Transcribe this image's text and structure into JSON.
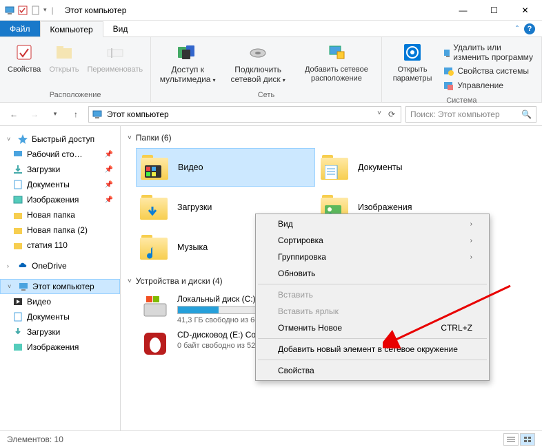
{
  "window": {
    "title": "Этот компьютер"
  },
  "winControls": {
    "min": "—",
    "max": "☐",
    "close": "✕"
  },
  "menuTabs": {
    "file": "Файл",
    "computer": "Компьютер",
    "view": "Вид"
  },
  "ribbon": {
    "group1": {
      "label": "Расположение",
      "props": "Свойства",
      "open": "Открыть",
      "rename": "Переименовать"
    },
    "group2": {
      "label": "Сеть",
      "media": "Доступ к мультимедиа",
      "mapDrive": "Подключить сетевой диск",
      "addNet": "Добавить сетевое расположение"
    },
    "group3": {
      "label": "Система",
      "settings": "Открыть параметры",
      "uninstall": "Удалить или изменить программу",
      "sysprops": "Свойства системы",
      "manage": "Управление"
    }
  },
  "address": {
    "text": "Этот компьютер"
  },
  "search": {
    "placeholder": "Поиск: Этот компьютер"
  },
  "sidebar": {
    "quick": "Быстрый доступ",
    "desktop": "Рабочий сто…",
    "downloads": "Загрузки",
    "documents": "Документы",
    "pictures": "Изображения",
    "newFolder": "Новая папка",
    "newFolder2": "Новая папка (2)",
    "statiya": "статия 110",
    "onedrive": "OneDrive",
    "thispc": "Этот компьютер",
    "videos": "Видео",
    "documents2": "Документы",
    "downloads2": "Загрузки",
    "pictures2": "Изображения"
  },
  "sections": {
    "folders": "Папки (6)",
    "devices": "Устройства и диски (4)"
  },
  "folders": {
    "videos": "Видео",
    "documents": "Документы",
    "downloads": "Загрузки",
    "pictures": "Изображения",
    "music": "Музыка"
  },
  "drives": {
    "c": {
      "name": "Локальный диск (C:)",
      "info": "41,3 ГБ свободно из 60,6…",
      "fillPct": 33
    },
    "e": {
      "name": "CD-дисковод (E:) Conne… Manager",
      "info": "0 байт свободно из 52,1…"
    }
  },
  "contextMenu": {
    "view": "Вид",
    "sort": "Сортировка",
    "group": "Группировка",
    "refresh": "Обновить",
    "paste": "Вставить",
    "pasteShortcut": "Вставить ярлык",
    "undo": "Отменить Новое",
    "undoKey": "CTRL+Z",
    "addNetwork": "Добавить новый элемент в сетевое окружение",
    "properties": "Свойства"
  },
  "status": {
    "elements": "Элементов: 10"
  }
}
